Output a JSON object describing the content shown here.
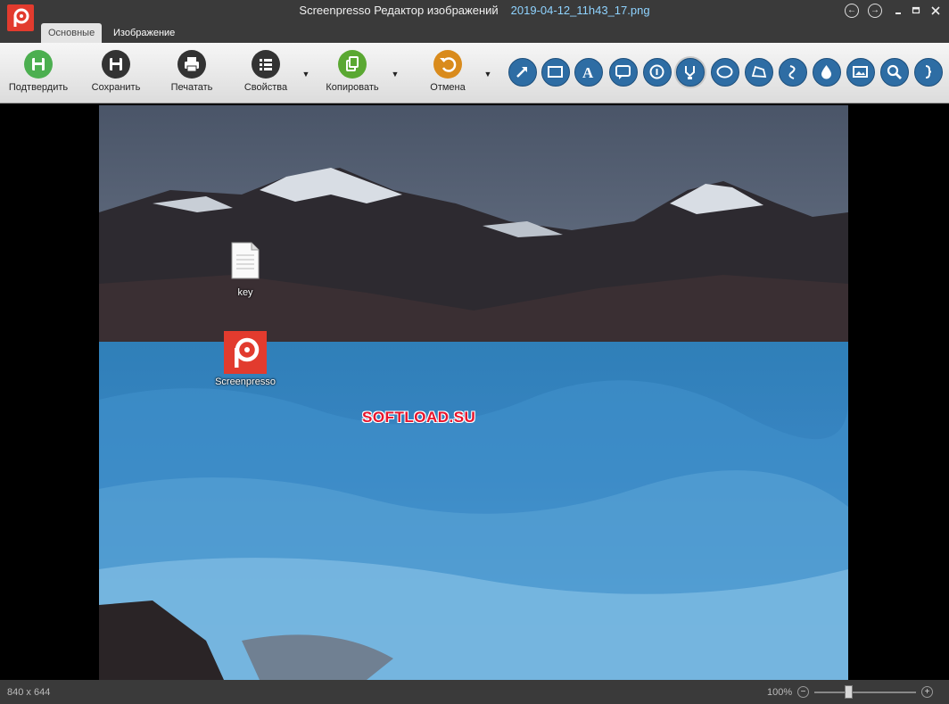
{
  "window": {
    "title": "Screenpresso Редактор изображений",
    "filename": "2019-04-12_11h43_17.png"
  },
  "tabs": [
    {
      "label": "Основные",
      "active": true
    },
    {
      "label": "Изображение",
      "active": false
    }
  ],
  "ribbon": {
    "confirm_label": "Подтвердить",
    "save_label": "Сохранить",
    "print_label": "Печатать",
    "properties_label": "Свойства",
    "copy_label": "Копировать",
    "undo_label": "Отмена"
  },
  "tools": [
    "arrow-icon",
    "rectangle-icon",
    "text-icon",
    "callout-icon",
    "step-number-icon",
    "highlighter-icon",
    "ellipse-icon",
    "polygon-icon",
    "freehand-icon",
    "blur-icon",
    "image-icon",
    "magnifier-icon",
    "bracket-icon"
  ],
  "colors": {
    "accent": "#e23b2e",
    "tool_blue": "#2e6da4",
    "confirm_green": "#4caf50",
    "copy_green": "#5aa832",
    "undo_orange": "#d98b1c",
    "filename_blue": "#8fd3ff"
  },
  "desktop": {
    "file_icon_label": "key",
    "app_icon_label": "Screenpresso",
    "watermark": "SOFTLOAD.SU"
  },
  "status": {
    "dimensions": "840 x 644",
    "zoom": "100%",
    "zoom_level": 1.0
  }
}
